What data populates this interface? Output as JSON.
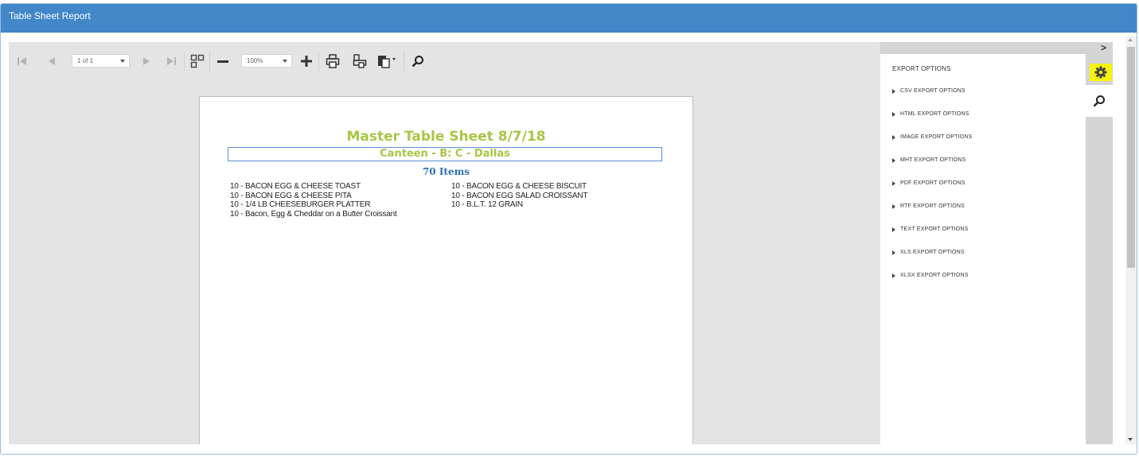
{
  "window": {
    "title": "Table Sheet Report"
  },
  "toolbar": {
    "page_selector": "1 of 1",
    "zoom": "100%",
    "icons": [
      "first-page-icon",
      "prev-page-icon",
      "next-page-icon",
      "last-page-icon",
      "multipage-icon",
      "zoom-out-icon",
      "zoom-in-icon",
      "print-icon",
      "print-page-icon",
      "export-icon",
      "search-icon"
    ]
  },
  "report": {
    "title": "Master Table Sheet  8/7/18",
    "subtitle": "Canteen - B: C - Dallas",
    "count": "70 Items",
    "items": [
      "10 - BACON EGG & CHEESE TOAST",
      "10 - BACON EGG & CHEESE BISCUIT",
      "10 - BACON EGG & CHEESE PITA",
      "10 - BACON  EGG SALAD CROISSANT",
      "10 - 1/4 LB CHEESEBURGER PLATTER",
      "10 - B.L.T. 12 GRAIN",
      "10 - Bacon, Egg & Cheddar on a Butter Croissant"
    ],
    "colors": {
      "title": "#a8c545",
      "count": "#2b72b5"
    }
  },
  "export_panel": {
    "title": "EXPORT OPTIONS",
    "options": [
      "CSV EXPORT OPTIONS",
      "HTML EXPORT OPTIONS",
      "IMAGE EXPORT OPTIONS",
      "MHT EXPORT OPTIONS",
      "PDF EXPORT OPTIONS",
      "RTF EXPORT OPTIONS",
      "TEXT EXPORT OPTIONS",
      "XLS EXPORT OPTIONS",
      "XLSX EXPORT OPTIONS"
    ],
    "collapse_label": ">",
    "active_tab_color": "#f6f40a"
  },
  "theme": {
    "header_bg": "#4287c8",
    "viewer_bg": "#e4e4e4"
  }
}
